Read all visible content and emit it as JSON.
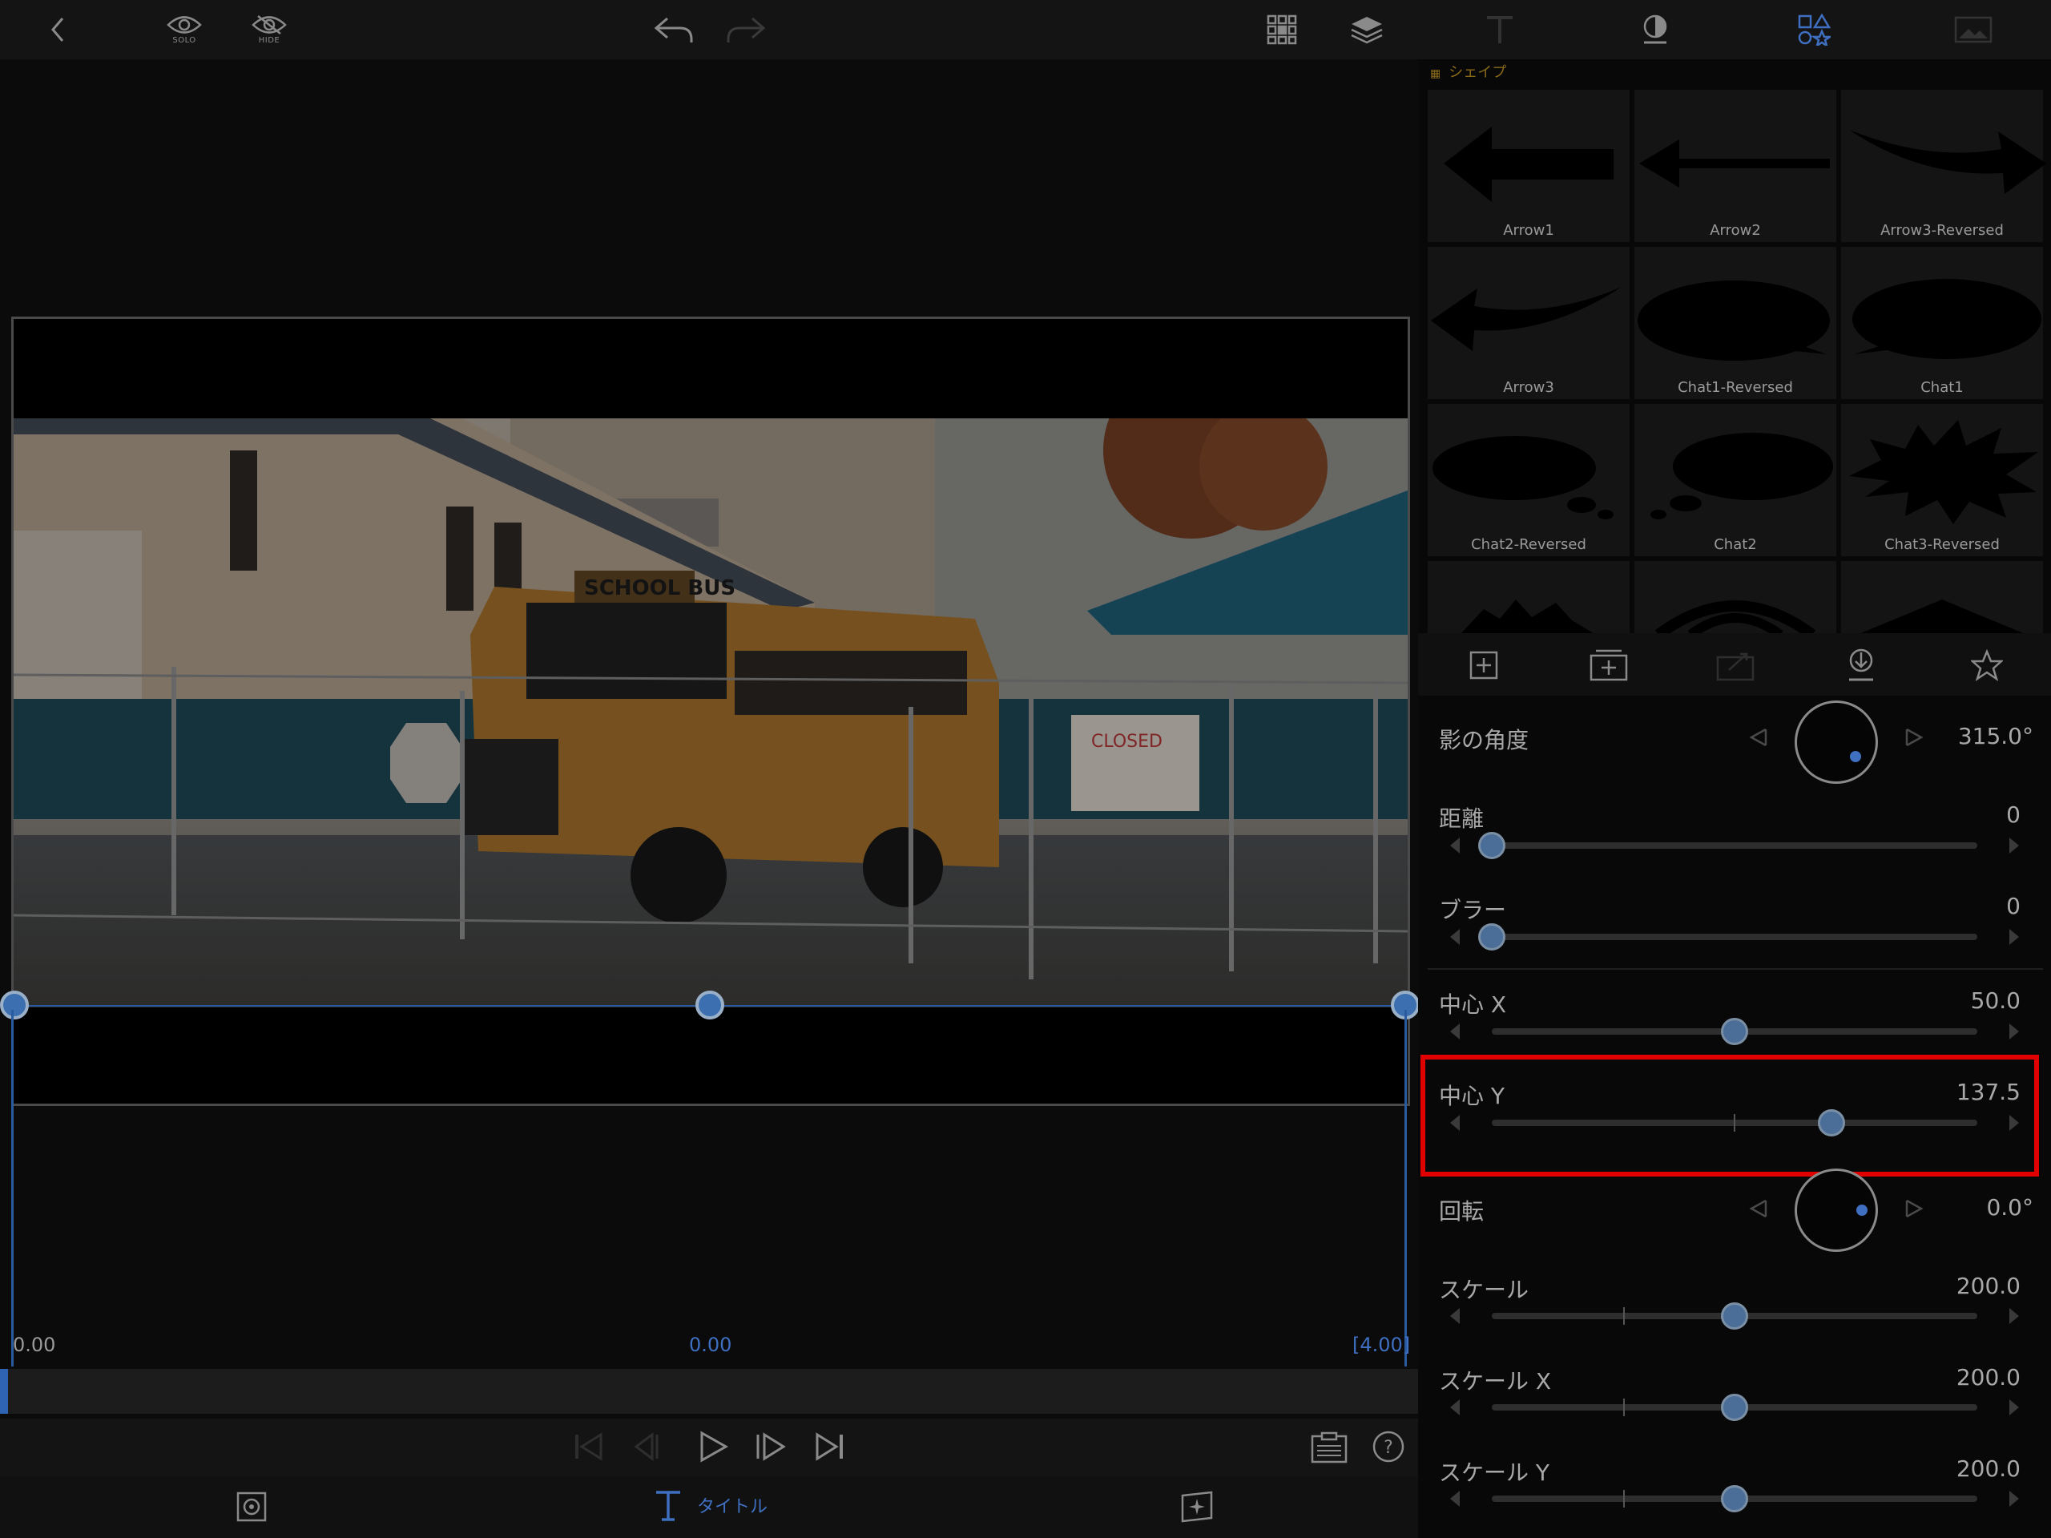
{
  "toolbar": {
    "solo_label": "SOLO",
    "hide_label": "HIDE"
  },
  "shapes": {
    "header": "シェイプ",
    "items": [
      {
        "label": "Arrow1"
      },
      {
        "label": "Arrow2"
      },
      {
        "label": "Arrow3-Reversed"
      },
      {
        "label": "Arrow3"
      },
      {
        "label": "Chat1-Reversed"
      },
      {
        "label": "Chat1"
      },
      {
        "label": "Chat2-Reversed"
      },
      {
        "label": "Chat2"
      },
      {
        "label": "Chat3-Reversed"
      }
    ]
  },
  "properties": {
    "shadow_angle": {
      "label": "影の角度",
      "value": "315.0°"
    },
    "distance": {
      "label": "距離",
      "value": "0",
      "fraction": 0.0
    },
    "blur": {
      "label": "ブラー",
      "value": "0",
      "fraction": 0.0
    },
    "center_x": {
      "label": "中心 X",
      "value": "50.0",
      "fraction": 0.5
    },
    "center_y": {
      "label": "中心 Y",
      "value": "137.5",
      "fraction": 0.7
    },
    "rotation": {
      "label": "回転",
      "value": "0.0°"
    },
    "scale": {
      "label": "スケール",
      "value": "200.0",
      "fraction": 0.5
    },
    "scale_x": {
      "label": "スケール X",
      "value": "200.0",
      "fraction": 0.5
    },
    "scale_y": {
      "label": "スケール Y",
      "value": "200.0",
      "fraction": 0.5
    }
  },
  "timeline": {
    "start_time": "0.00",
    "current_time": "0.00",
    "end_time": "[4.00]"
  },
  "bottom_bar": {
    "title_tab_label": "タイトル"
  },
  "colors": {
    "accent": "#3f6fc0",
    "highlight": "#e00000",
    "shape_header": "#8a6a1a"
  }
}
